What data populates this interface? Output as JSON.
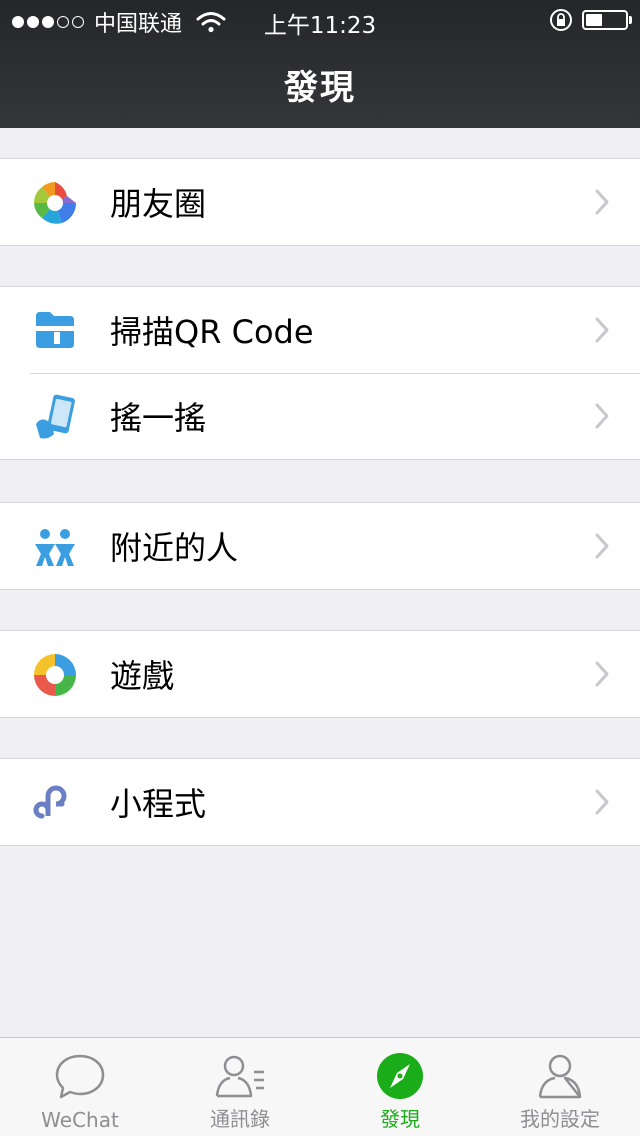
{
  "status_bar": {
    "carrier": "中国联通",
    "time": "上午11:23"
  },
  "header": {
    "title": "發現"
  },
  "groups": [
    {
      "items": [
        {
          "label": "朋友圈",
          "icon": "moments-icon"
        }
      ]
    },
    {
      "items": [
        {
          "label": "掃描QR Code",
          "icon": "scan-qr-icon"
        },
        {
          "label": "搖一搖",
          "icon": "shake-icon"
        }
      ]
    },
    {
      "items": [
        {
          "label": "附近的人",
          "icon": "people-nearby-icon"
        }
      ]
    },
    {
      "items": [
        {
          "label": "遊戲",
          "icon": "games-icon"
        }
      ]
    },
    {
      "items": [
        {
          "label": "小程式",
          "icon": "mini-programs-icon"
        }
      ]
    }
  ],
  "tabbar": {
    "tabs": [
      {
        "label": "WeChat",
        "icon": "chat-bubble-icon",
        "active": false
      },
      {
        "label": "通訊錄",
        "icon": "contacts-icon",
        "active": false
      },
      {
        "label": "發現",
        "icon": "compass-icon",
        "active": true
      },
      {
        "label": "我的設定",
        "icon": "person-icon",
        "active": false
      }
    ]
  },
  "colors": {
    "header_bg": "#2b2c30",
    "page_bg": "#efeff4",
    "active_tab": "#1aad19",
    "inactive_tab": "#8e8e93",
    "icon_blue": "#3a9ee0",
    "mini_program_purple": "#6b7fc4"
  }
}
